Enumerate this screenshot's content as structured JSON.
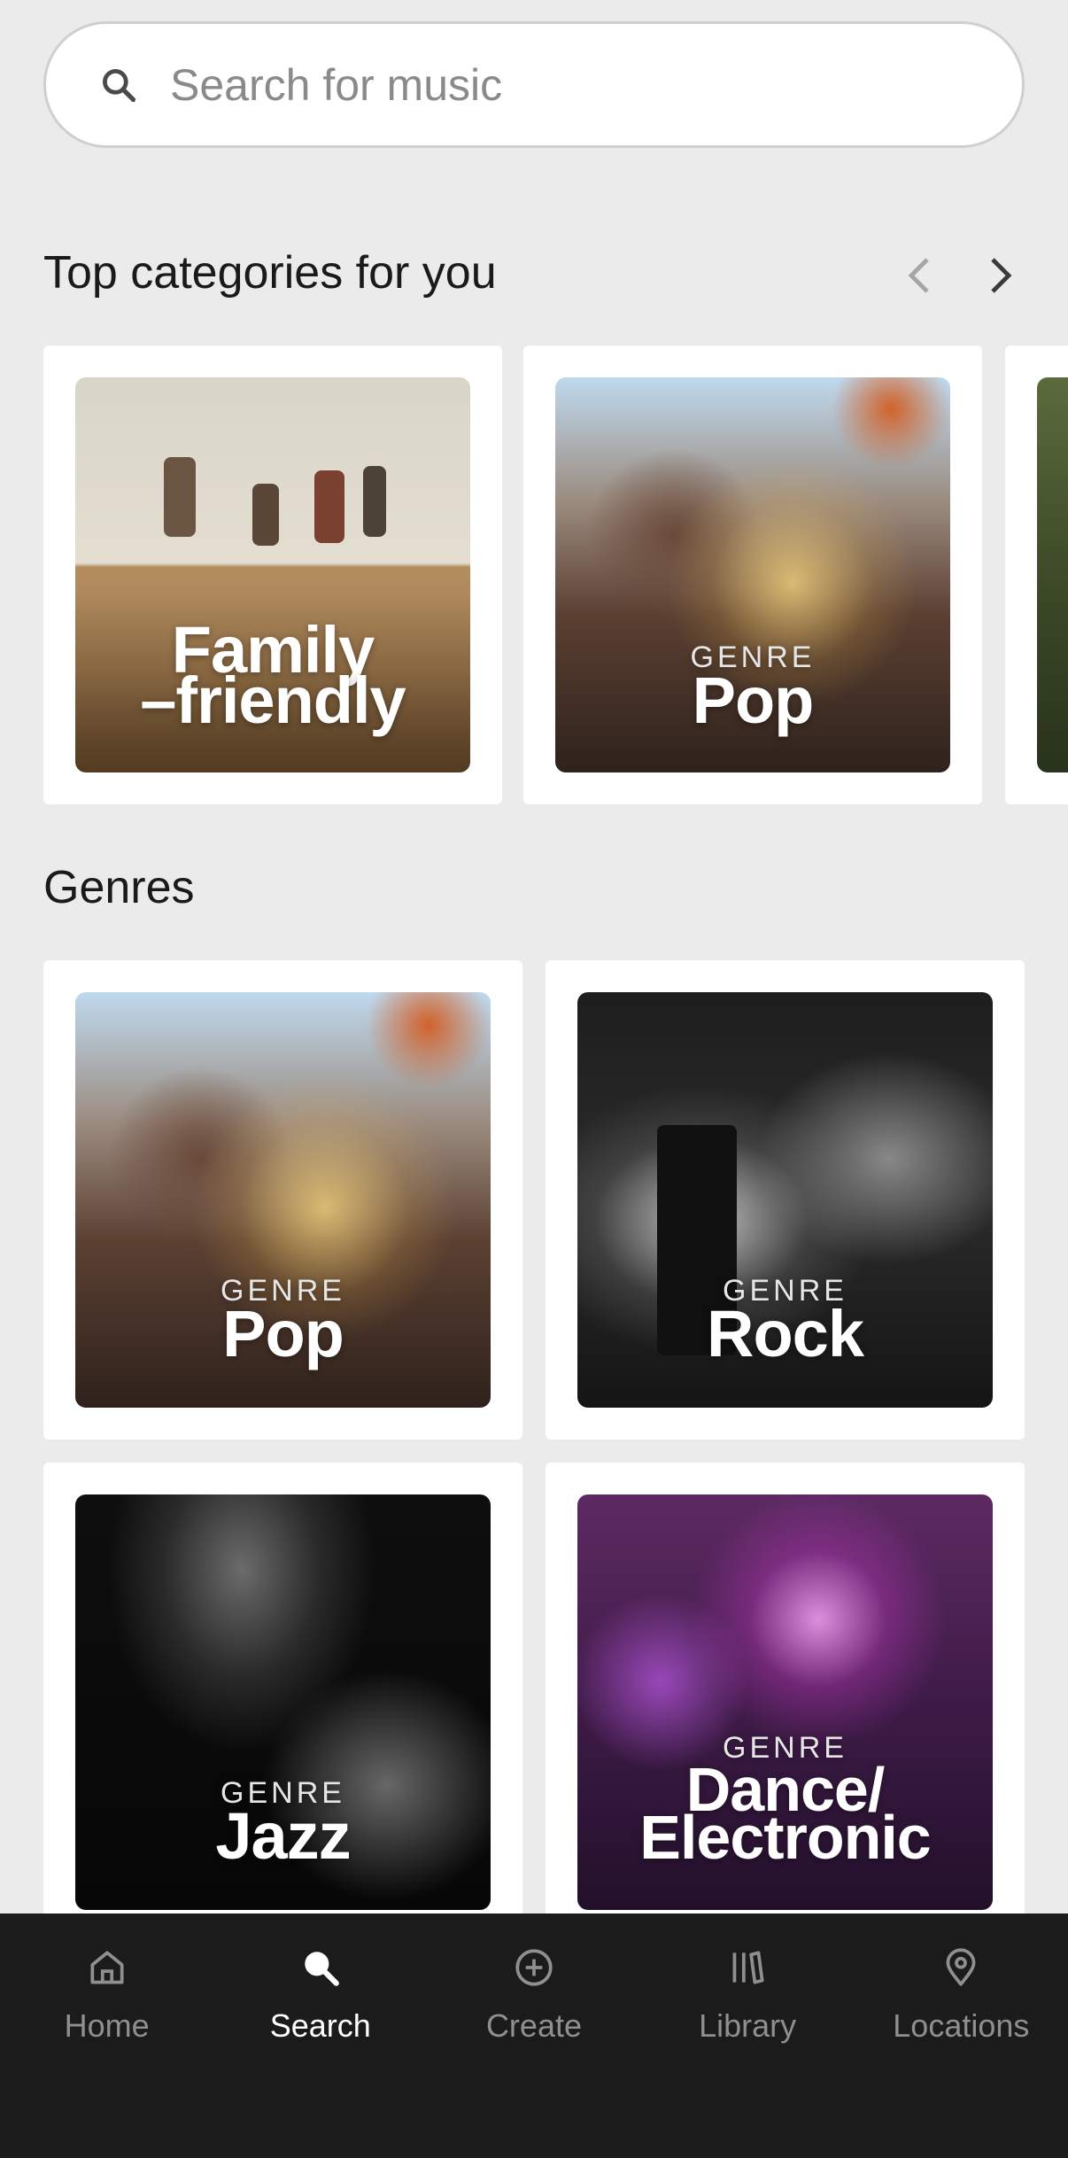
{
  "search": {
    "placeholder": "Search for music"
  },
  "top_categories": {
    "title": "Top categories for you",
    "cards": [
      {
        "kicker": "",
        "title_line1": "Family",
        "title_line2": "–friendly"
      },
      {
        "kicker": "GENRE",
        "title": "Pop"
      }
    ]
  },
  "genres": {
    "title": "Genres",
    "cards": [
      {
        "kicker": "GENRE",
        "title": "Pop"
      },
      {
        "kicker": "GENRE",
        "title": "Rock"
      },
      {
        "kicker": "GENRE",
        "title": "Jazz"
      },
      {
        "kicker": "GENRE",
        "title_line1": "Dance/",
        "title_line2": "Electronic"
      }
    ]
  },
  "bottom_nav": {
    "items": [
      {
        "label": "Home",
        "icon": "home-icon"
      },
      {
        "label": "Search",
        "icon": "search-icon",
        "active": true
      },
      {
        "label": "Create",
        "icon": "plus-circle-icon"
      },
      {
        "label": "Library",
        "icon": "library-icon"
      },
      {
        "label": "Locations",
        "icon": "location-pin-icon"
      }
    ]
  },
  "colors": {
    "background": "#ebebeb",
    "nav_background": "#1b1b1b",
    "nav_active": "#ffffff",
    "nav_inactive": "#8f8f8f"
  }
}
